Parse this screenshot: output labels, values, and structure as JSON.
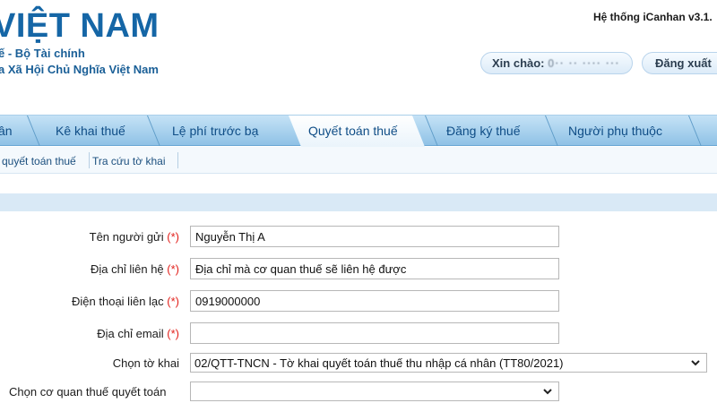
{
  "header": {
    "brand_title": "VIỆT NAM",
    "brand_sub1": "ế - Bộ Tài chính",
    "brand_sub2": "a Xã Hội Chủ Nghĩa Việt Nam",
    "system_version": "Hệ thống iCanhan v3.1.",
    "greeting_label": "Xin chào:",
    "greeting_user_masked": "0·· ·· ···· ···",
    "logout_label": "Đăng xuất"
  },
  "tabs": [
    {
      "label": "ân"
    },
    {
      "label": "Kê khai thuế"
    },
    {
      "label": "Lệ phí trước bạ"
    },
    {
      "label": "Quyết toán thuế",
      "active": true
    },
    {
      "label": "Đăng ký thuế"
    },
    {
      "label": "Người phụ thuộc"
    }
  ],
  "submenu": {
    "item1": "quyết toán thuế",
    "item2": "Tra cứu tờ khai"
  },
  "form": {
    "required_mark": "(*)",
    "sender_name_label": "Tên người gửi",
    "sender_name_value": "Nguyễn Thị A",
    "address_label": "Địa chỉ liên hệ",
    "address_value": "Địa chỉ mà cơ quan thuế sẽ liên hệ được",
    "phone_label": "Điện thoại liên lạc",
    "phone_value": "0919000000",
    "email_label": "Địa chỉ email",
    "email_value": "",
    "declaration_label": "Chọn tờ khai",
    "declaration_value": "02/QTT-TNCN - Tờ khai quyết toán thuế thu nhập cá nhân (TT80/2021)",
    "tax_office_label": "Chọn cơ quan thuế quyết toán",
    "tax_office_value": ""
  },
  "colors": {
    "brand_blue": "#1566a6",
    "tab_text": "#0f4d86",
    "required_red": "#e2211c",
    "tabbar_light": "#c5e2f6",
    "tabbar_dark": "#8fc2e6"
  }
}
